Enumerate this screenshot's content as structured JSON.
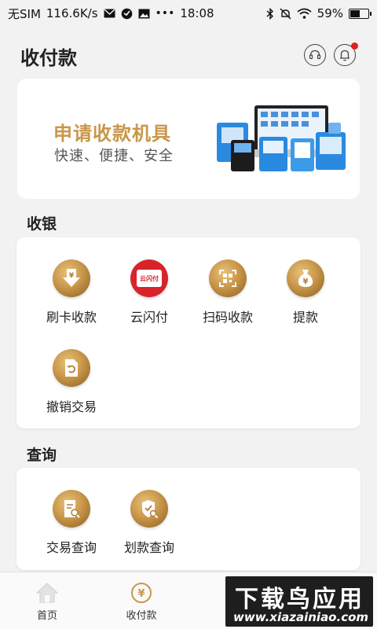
{
  "status_bar": {
    "carrier": "无SIM",
    "speed": "116.6K/s",
    "time": "18:08",
    "battery": "59%",
    "battery_level": 0.59
  },
  "header": {
    "title": "收付款"
  },
  "banner": {
    "title": "申请收款机具",
    "subtitle": "快速、便捷、安全"
  },
  "sections": {
    "cashier": {
      "title": "收银",
      "items": [
        {
          "label": "刷卡收款",
          "icon": "card-download-icon"
        },
        {
          "label": "云闪付",
          "icon": "yunshanfu-icon",
          "badge": "云闪付"
        },
        {
          "label": "扫码收款",
          "icon": "qr-scan-icon"
        },
        {
          "label": "提款",
          "icon": "money-bag-icon"
        },
        {
          "label": "撤销交易",
          "icon": "undo-doc-icon"
        }
      ]
    },
    "query": {
      "title": "查询",
      "items": [
        {
          "label": "交易查询",
          "icon": "doc-search-icon"
        },
        {
          "label": "划款查询",
          "icon": "shield-search-icon"
        }
      ]
    }
  },
  "bottom_nav": [
    {
      "label": "首页",
      "icon": "home-icon"
    },
    {
      "label": "收付款",
      "icon": "yuan-circle-icon"
    }
  ],
  "watermark": {
    "title": "下载鸟应用",
    "url": "www.xiazainiao.com"
  },
  "colors": {
    "gold": "#c9974a",
    "background": "#f2f2f2",
    "notification_dot": "#e02020"
  }
}
